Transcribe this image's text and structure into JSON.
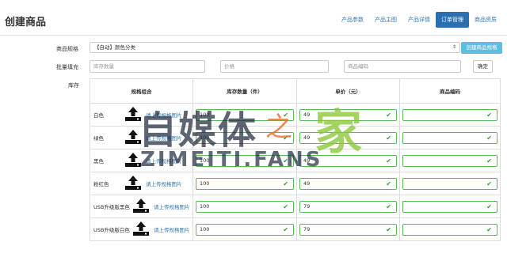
{
  "header": {
    "title": "创建商品",
    "tabs": [
      {
        "label": "产品参数",
        "active": false
      },
      {
        "label": "产品主图",
        "active": false
      },
      {
        "label": "产品详情",
        "active": false
      },
      {
        "label": "订单管理",
        "active": true
      },
      {
        "label": "商品资质",
        "active": false
      }
    ]
  },
  "form": {
    "spec_label": "商品规格",
    "spec_value": "【自动】颜色分类",
    "create_spec_button": "创建商品规格",
    "bulk_label": "批量填充",
    "bulk_stock_placeholder": "库存数量",
    "bulk_price_placeholder": "价格",
    "bulk_code_placeholder": "商品编码",
    "confirm_button": "确定",
    "stock_label": "库存"
  },
  "table": {
    "headers": [
      "规格组合",
      "库存数量（件）",
      "单价（元）",
      "商品编码"
    ],
    "upload_label": "请上传规格图片",
    "rows": [
      {
        "spec": "白色",
        "stock": "100",
        "price": "49",
        "code": ""
      },
      {
        "spec": "绿色",
        "stock": "100",
        "price": "49",
        "code": ""
      },
      {
        "spec": "黑色",
        "stock": "100",
        "price": "49",
        "code": ""
      },
      {
        "spec": "粉红色",
        "stock": "100",
        "price": "49",
        "code": ""
      },
      {
        "spec": "USB升级版黑色",
        "stock": "100",
        "price": "79",
        "code": ""
      },
      {
        "spec": "USB升级版白色",
        "stock": "100",
        "price": "79",
        "code": ""
      }
    ]
  },
  "watermark": {
    "big": "自媒体",
    "zhi": "之",
    "jia": "家",
    "small": "ZIMEITI.FANS"
  },
  "colors": {
    "accent": "#2a6fb0",
    "link": "#337ab7",
    "valid": "#5cb85c",
    "info_button": "#5bc0de"
  }
}
